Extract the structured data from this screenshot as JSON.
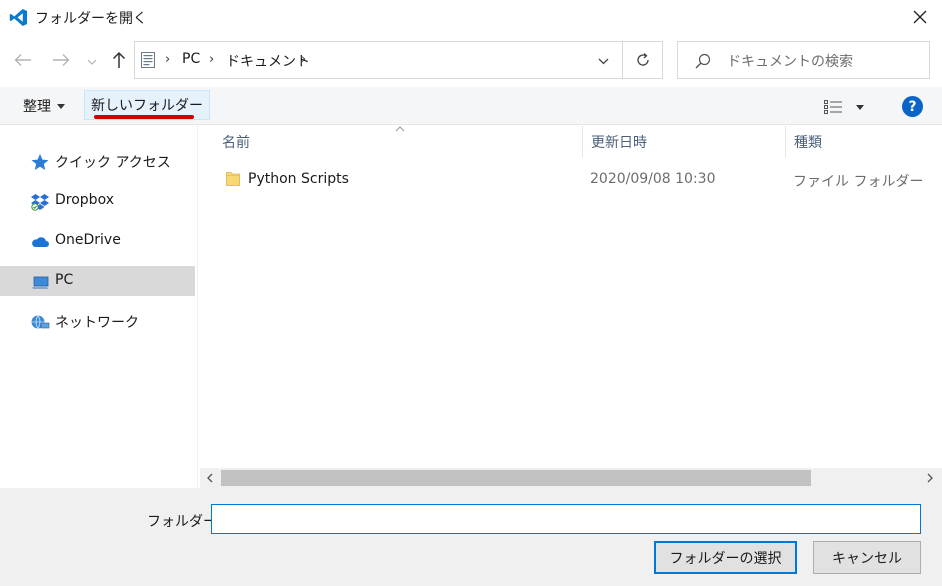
{
  "window": {
    "title": "フォルダーを開く",
    "close_glyph": "✕"
  },
  "navigation": {
    "breadcrumb": [
      "PC",
      "ドキュメント"
    ],
    "search_placeholder": "ドキュメントの検索"
  },
  "toolbar": {
    "organize_label": "整理",
    "new_folder_label": "新しいフォルダー",
    "help_label": "?"
  },
  "sidebar": {
    "items": [
      {
        "label": "クイック アクセス",
        "icon": "star-icon",
        "selected": false
      },
      {
        "label": "Dropbox",
        "icon": "dropbox-icon",
        "selected": false
      },
      {
        "label": "OneDrive",
        "icon": "cloud-icon",
        "selected": false
      },
      {
        "label": "PC",
        "icon": "computer-icon",
        "selected": true
      },
      {
        "label": "ネットワーク",
        "icon": "network-icon",
        "selected": false
      }
    ]
  },
  "file_list": {
    "columns": [
      "名前",
      "更新日時",
      "種類"
    ],
    "rows": [
      {
        "name": "Python Scripts",
        "modified": "2020/09/08 10:30",
        "type": "ファイル フォルダー",
        "icon": "folder-icon"
      }
    ]
  },
  "footer": {
    "folder_label": "フォルダー:",
    "folder_value": "",
    "select_label": "フォルダーの選択",
    "cancel_label": "キャンセル"
  },
  "colors": {
    "accent": "#0078d7",
    "highlight_underline": "#d40000",
    "new_folder_bg": "#e5f1fb",
    "selected_nav": "#d9d9d9"
  }
}
